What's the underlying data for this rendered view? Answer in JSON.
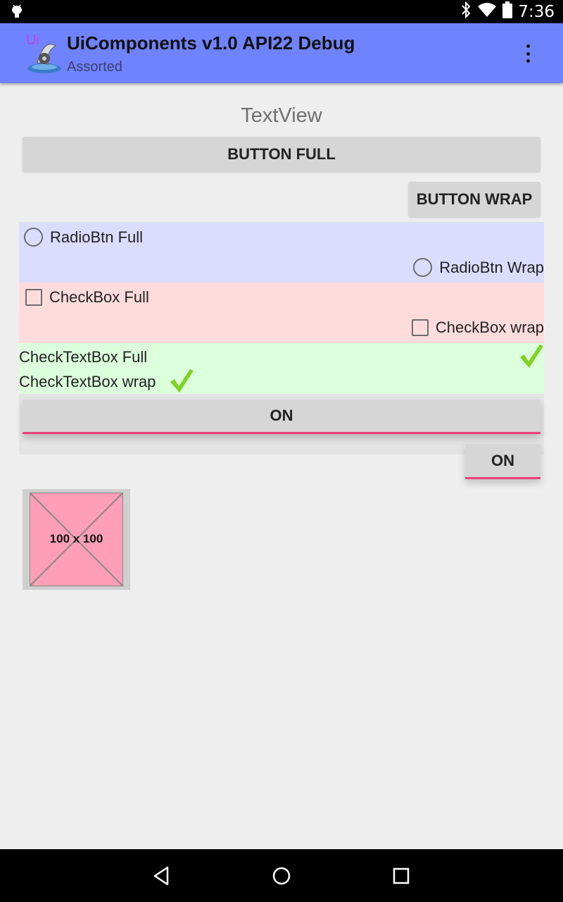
{
  "status_bar": {
    "time": "7:36",
    "icons": [
      "android-debug-icon",
      "bluetooth-icon",
      "wifi-icon",
      "battery-icon"
    ]
  },
  "app_bar": {
    "title": "UiComponents v1.0 API22 Debug",
    "subtitle": "Assorted",
    "logo_text": "Ui",
    "overflow_icon": "more-vert-icon",
    "color": "#7083ff"
  },
  "content": {
    "text_view": "TextView",
    "button_full": "BUTTON FULL",
    "button_wrap": "BUTTON WRAP",
    "radio_full": "RadioBtn Full",
    "radio_wrap": "RadioBtn Wrap",
    "checkbox_full": "CheckBox Full",
    "checkbox_wrap": "CheckBox wrap",
    "checktext_full": "CheckTextBox Full",
    "checktext_wrap": "CheckTextBox wrap",
    "toggle_full": "ON",
    "toggle_wrap": "ON",
    "image_label": "100 x 100"
  },
  "colors": {
    "radio_bg": "#dcdcff",
    "checkbox_bg": "#ffdcdc",
    "checktext_bg": "#dcffdc",
    "toggle_accent": "#ec407a",
    "check_mark": "#7ed321",
    "image_bg": "#ff9eb8"
  },
  "nav_bar": {
    "icons": [
      "back-icon",
      "home-icon",
      "recents-icon"
    ]
  }
}
